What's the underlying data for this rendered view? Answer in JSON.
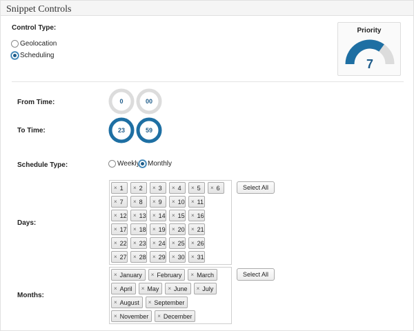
{
  "panel": {
    "title": "Snippet Controls"
  },
  "control_type": {
    "label": "Control Type:",
    "options": [
      {
        "label": "Geolocation",
        "checked": false
      },
      {
        "label": "Scheduling",
        "checked": true
      }
    ]
  },
  "priority": {
    "title": "Priority",
    "value": 7,
    "max": 10
  },
  "from_time": {
    "label": "From Time:",
    "hour": "0",
    "minute": "00"
  },
  "to_time": {
    "label": "To Time:",
    "hour": "23",
    "minute": "59"
  },
  "schedule_type": {
    "label": "Schedule Type:",
    "options": [
      {
        "label": "Weekly",
        "checked": false
      },
      {
        "label": "Monthly",
        "checked": true
      }
    ]
  },
  "days": {
    "label": "Days:",
    "select_all_label": "Select All",
    "rows": [
      [
        "1",
        "2",
        "3",
        "4",
        "5",
        "6"
      ],
      [
        "7",
        "8",
        "9",
        "10",
        "11"
      ],
      [
        "12",
        "13",
        "14",
        "15",
        "16"
      ],
      [
        "17",
        "18",
        "19",
        "20",
        "21"
      ],
      [
        "22",
        "23",
        "24",
        "25",
        "26"
      ],
      [
        "27",
        "28",
        "29",
        "30",
        "31"
      ]
    ]
  },
  "months": {
    "label": "Months:",
    "select_all_label": "Select All",
    "rows": [
      [
        "January",
        "February",
        "March"
      ],
      [
        "April",
        "May",
        "June",
        "July"
      ],
      [
        "August",
        "September"
      ],
      [
        "November",
        "December"
      ]
    ]
  },
  "colors": {
    "accent": "#1e6fa3",
    "dial_empty": "#dcdcdc",
    "dial_text": "#1e5c8a"
  },
  "icons": {
    "remove": "×"
  }
}
